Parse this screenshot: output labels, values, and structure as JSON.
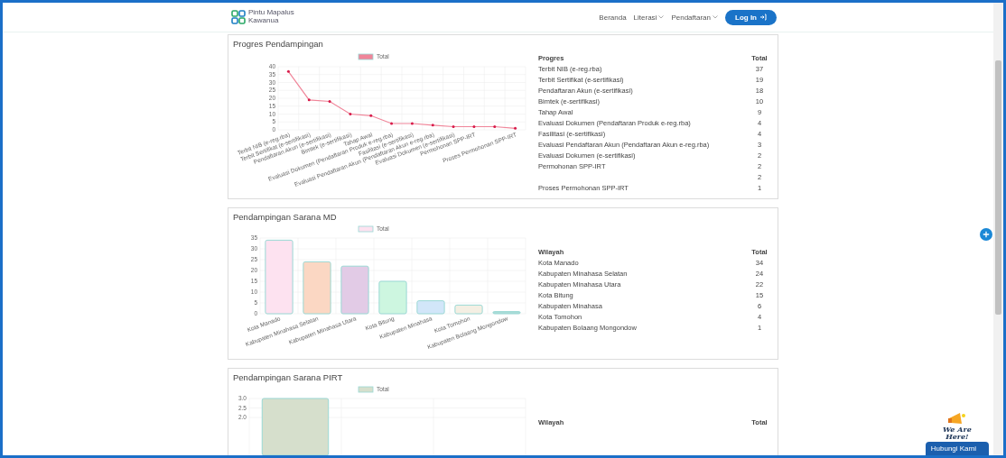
{
  "header": {
    "logo_line_1": "Pintu Mapalus",
    "logo_line_2": "Kawanua",
    "nav": [
      {
        "label": "Beranda",
        "dropdown": false
      },
      {
        "label": "Literasi",
        "dropdown": true
      },
      {
        "label": "Pendaftaran",
        "dropdown": true
      }
    ],
    "login_button": "Log In"
  },
  "cards": [
    {
      "title": "Progres Pendampingan",
      "table": {
        "columns": [
          "Progres",
          "Total"
        ],
        "rows": [
          {
            "name": "Terbit NIB (e-reg.rba)",
            "total": "37"
          },
          {
            "name": "Terbit Sertifikat (e-sertifikasi)",
            "total": "19"
          },
          {
            "name": "Pendaftaran Akun (e-sertifikasi)",
            "total": "18"
          },
          {
            "name": "Bimtek (e-sertifikasi)",
            "total": "10"
          },
          {
            "name": "Tahap Awal",
            "total": "9"
          },
          {
            "name": "Evaluasi Dokumen (Pendaftaran Produk e-reg.rba)",
            "total": "4"
          },
          {
            "name": "Fasilitasi (e-sertifikasi)",
            "total": "4"
          },
          {
            "name": "Evaluasi Pendaftaran Akun (Pendaftaran Akun e-reg.rba)",
            "total": "3"
          },
          {
            "name": "Evaluasi Dokumen (e-sertifikasi)",
            "total": "2"
          },
          {
            "name": "Permohonan SPP-IRT",
            "total": "2"
          },
          {
            "total": "2"
          },
          {
            "name": "Proses Permohonan SPP-IRT",
            "total": "1"
          }
        ]
      },
      "chart_data": {
        "type": "line",
        "categories": [
          "Terbit NIB (e-reg.rba)",
          "Terbit Sertifikat (e-sertifikasi)",
          "Pendaftaran Akun (e-sertifikasi)",
          "Bimtek (e-sertifikasi)",
          "Tahap Awal",
          "Evaluasi Dokumen (Pendaftaran Produk e-reg.rba)",
          "Fasilitasi (e-sertifikasi)",
          "Evaluasi Pendaftaran Akun (Pendaftaran Akun e-reg.rba)",
          "Evaluasi Dokumen (e-sertifikasi)",
          "Permohonan SPP-IRT",
          null,
          "Proses Permohonan SPP-IRT"
        ],
        "series": [
          {
            "name": "Total",
            "color": "#f08599",
            "values": [
              37,
              19,
              18,
              10,
              9,
              4,
              4,
              3,
              2,
              2,
              2,
              1
            ]
          }
        ],
        "grid": true,
        "ylim": [
          0,
          40
        ],
        "yticks": [
          0,
          5,
          10,
          15,
          20,
          25,
          30,
          35,
          40
        ]
      }
    },
    {
      "title": "Pendampingan Sarana MD",
      "table": {
        "columns": [
          "Wilayah",
          "Total"
        ],
        "rows": [
          {
            "name": "Kota Manado",
            "total": "34"
          },
          {
            "name": "Kabupaten Minahasa Selatan",
            "total": "24"
          },
          {
            "name": "Kabupaten Minahasa Utara",
            "total": "22"
          },
          {
            "name": "Kota Bitung",
            "total": "15"
          },
          {
            "name": "Kabupaten Minahasa",
            "total": "6"
          },
          {
            "name": "Kota Tomohon",
            "total": "4"
          },
          {
            "name": "Kabupaten Bolaang Mongondow",
            "total": "1"
          }
        ]
      },
      "chart_data": {
        "type": "bar",
        "categories": [
          "Kota Manado",
          "Kabupaten Minahasa Selatan",
          "Kabupaten Minahasa Utara",
          "Kota Bitung",
          "Kabupaten Minahasa",
          "Kota Tomohon",
          "Kabupaten Bolaang Mongondow"
        ],
        "series": [
          {
            "name": "Total",
            "color": "#9ad8d4",
            "colors": [
              "#fde2f0",
              "#fbd7c3",
              "#e2cbe6",
              "#cdf6e0",
              "#d2e6f9",
              "#f4efe3",
              "#a9dcd8"
            ],
            "values": [
              34,
              24,
              22,
              15,
              6,
              4,
              1
            ]
          }
        ],
        "grid": true,
        "ylim": [
          0,
          35
        ],
        "yticks": [
          0,
          5,
          10,
          15,
          20,
          25,
          30,
          35
        ]
      }
    },
    {
      "title": "Pendampingan Sarana PIRT",
      "table": {
        "columns": [
          "Wilayah",
          "Total"
        ]
      },
      "chart_data": {
        "type": "bar",
        "series": [
          {
            "name": "Total",
            "color": "#d6dfcc",
            "values": [
              3,
              null,
              null
            ]
          }
        ],
        "grid": true,
        "ylim": [
          0,
          3
        ],
        "yticks": [
          {
            "value": 2,
            "label": "2.0"
          },
          {
            "value": 2.5,
            "label": "2.5"
          },
          {
            "value": 3,
            "label": "3.0"
          }
        ]
      }
    }
  ],
  "chat_widget": {
    "tagline_1": "We Are",
    "tagline_2": "Here!",
    "button": "Hubungi Kami"
  }
}
